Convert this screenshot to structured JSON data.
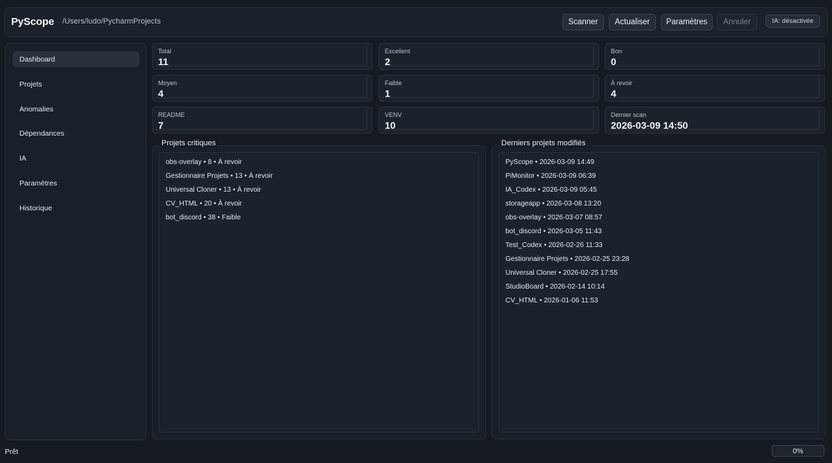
{
  "header": {
    "title": "PyScope",
    "path": "/Users/ludo/PycharmProjects",
    "buttons": {
      "scan": "Scanner",
      "refresh": "Actualiser",
      "settings": "Paramètres",
      "cancel": "Annuler"
    },
    "ia_status": "IA: désactivée"
  },
  "sidebar": {
    "items": [
      {
        "label": "Dashboard",
        "active": true
      },
      {
        "label": "Projets"
      },
      {
        "label": "Anomalies"
      },
      {
        "label": "Dépendances"
      },
      {
        "label": "IA"
      },
      {
        "label": "Paramètres"
      },
      {
        "label": "Historique"
      }
    ]
  },
  "stats": [
    {
      "label": "Total",
      "value": "11"
    },
    {
      "label": "Excellent",
      "value": "2"
    },
    {
      "label": "Bon",
      "value": "0"
    },
    {
      "label": "Moyen",
      "value": "4"
    },
    {
      "label": "Faible",
      "value": "1"
    },
    {
      "label": "À revoir",
      "value": "4"
    },
    {
      "label": "README",
      "value": "7"
    },
    {
      "label": "VENV",
      "value": "10"
    },
    {
      "label": "Dernier scan",
      "value": "2026-03-09 14:50"
    }
  ],
  "critical": {
    "title": "Projets critiques",
    "items": [
      "obs-overlay • 8 • À revoir",
      "Gestionnaire Projets • 13 • À revoir",
      "Universal Cloner • 13 • À revoir",
      "CV_HTML • 20 • À revoir",
      "bot_discord • 38 • Faible"
    ]
  },
  "recent": {
    "title": "Derniers projets modifiés",
    "items": [
      "PyScope • 2026-03-09 14:49",
      "PiMonitor • 2026-03-09 06:39",
      "IA_Codex • 2026-03-09 05:45",
      "storageapp • 2026-03-08 13:20",
      "obs-overlay • 2026-03-07 08:57",
      "bot_discord • 2026-03-05 11:43",
      "Test_Codex • 2026-02-26 11:33",
      "Gestionnaire Projets • 2026-02-25 23:28",
      "Universal Cloner • 2026-02-25 17:55",
      "StudioBoard • 2026-02-14 10:14",
      "CV_HTML • 2026-01-06 11:53"
    ]
  },
  "status": {
    "text": "Prêt",
    "progress": "0%"
  }
}
